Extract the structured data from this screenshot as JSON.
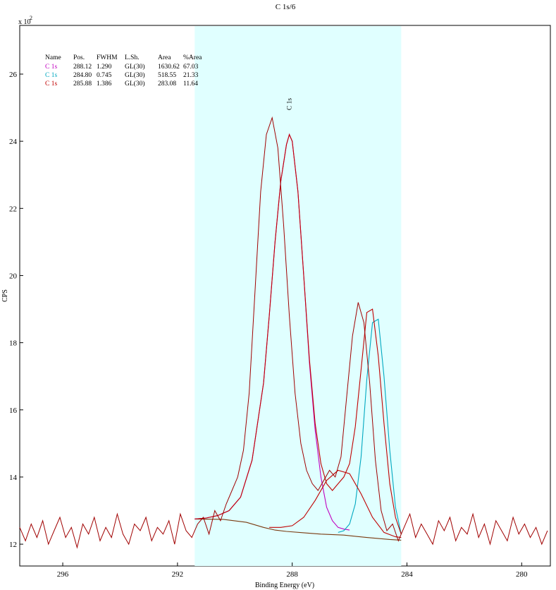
{
  "chart_data": {
    "type": "line",
    "title": "C 1s/6",
    "xlabel": "Binding Energy (eV)",
    "ylabel": "CPS",
    "y_multiplier_label": "x 10",
    "y_multiplier_exponent": "2",
    "xlim": [
      297.5,
      279
    ],
    "x_reversed": true,
    "ylim": [
      11.35,
      27.45
    ],
    "x_ticks": [
      296,
      292,
      288,
      284,
      280
    ],
    "y_ticks": [
      12,
      14,
      16,
      18,
      20,
      22,
      24,
      26
    ],
    "region": {
      "x_start": 291.4,
      "x_end": 284.2,
      "color": "#e0ffff"
    },
    "peak_label": {
      "text": "C 1s",
      "x": 288.1
    },
    "legend": {
      "headers": [
        "Name",
        "Pos.",
        "FWHM",
        "L.Sh.",
        "Area",
        "%Area"
      ],
      "rows": [
        {
          "name": "C 1s",
          "pos": "288.12",
          "fwhm": "1.290",
          "lsh": "GL(30)",
          "area": "1630.62",
          "pct": "67.03",
          "color": "#c000c0"
        },
        {
          "name": "C 1s",
          "pos": "284.80",
          "fwhm": "0.745",
          "lsh": "GL(30)",
          "area": "518.55",
          "pct": "21.33",
          "color": "#00a8c0"
        },
        {
          "name": "C 1s",
          "pos": "285.88",
          "fwhm": "1.386",
          "lsh": "GL(30)",
          "area": "283.08",
          "pct": "11.64",
          "color": "#c00000"
        }
      ]
    },
    "series": [
      {
        "role": "raw",
        "color": "#a00000",
        "x": [
          297.5,
          297.3,
          297.1,
          296.9,
          296.7,
          296.5,
          296.3,
          296.1,
          295.9,
          295.7,
          295.5,
          295.3,
          295.1,
          294.9,
          294.7,
          294.5,
          294.3,
          294.1,
          293.9,
          293.7,
          293.5,
          293.3,
          293.1,
          292.9,
          292.7,
          292.5,
          292.3,
          292.1,
          291.9,
          291.7,
          291.5,
          291.3,
          291.1,
          290.9,
          290.7,
          290.5,
          290.3,
          290.1,
          289.9,
          289.7,
          289.5,
          289.3,
          289.1,
          288.9,
          288.7,
          288.5,
          288.3,
          288.1,
          287.9,
          287.7,
          287.5,
          287.3,
          287.1,
          286.9,
          286.7,
          286.5,
          286.3,
          286.1,
          285.9,
          285.7,
          285.5,
          285.3,
          285.1,
          284.9,
          284.7,
          284.5,
          284.3,
          284.1,
          283.9,
          283.7,
          283.5,
          283.3,
          283.1,
          282.9,
          282.7,
          282.5,
          282.3,
          282.1,
          281.9,
          281.7,
          281.5,
          281.3,
          281.1,
          280.9,
          280.7,
          280.5,
          280.3,
          280.1,
          279.9,
          279.7,
          279.5,
          279.3,
          279.1
        ],
        "y": [
          12.5,
          12.1,
          12.6,
          12.2,
          12.7,
          12.0,
          12.4,
          12.8,
          12.2,
          12.5,
          11.9,
          12.6,
          12.3,
          12.8,
          12.1,
          12.5,
          12.2,
          12.9,
          12.3,
          12.0,
          12.6,
          12.4,
          12.8,
          12.1,
          12.5,
          12.3,
          12.7,
          12.0,
          12.9,
          12.4,
          12.2,
          12.6,
          12.8,
          12.3,
          13.0,
          12.7,
          13.2,
          13.6,
          14.0,
          14.8,
          16.5,
          19.5,
          22.5,
          24.2,
          24.7,
          23.8,
          21.5,
          18.8,
          16.5,
          15.0,
          14.2,
          13.8,
          13.6,
          13.9,
          14.2,
          14.0,
          14.6,
          16.4,
          18.2,
          19.2,
          18.6,
          16.8,
          14.5,
          13.0,
          12.4,
          12.6,
          12.1,
          12.5,
          12.9,
          12.2,
          12.6,
          12.3,
          12.0,
          12.7,
          12.4,
          12.8,
          12.1,
          12.5,
          12.3,
          12.9,
          12.2,
          12.6,
          12.0,
          12.7,
          12.4,
          12.1,
          12.8,
          12.3,
          12.6,
          12.2,
          12.5,
          12.0,
          12.4
        ]
      },
      {
        "role": "envelope",
        "color": "#c00000",
        "x": [
          291.4,
          291.0,
          290.6,
          290.2,
          289.8,
          289.4,
          289.0,
          288.8,
          288.6,
          288.4,
          288.2,
          288.1,
          288.0,
          287.8,
          287.6,
          287.4,
          287.2,
          287.0,
          286.8,
          286.6,
          286.4,
          286.2,
          286.0,
          285.8,
          285.6,
          285.4,
          285.2,
          285.0,
          284.8,
          284.6,
          284.4,
          284.2
        ],
        "y": [
          12.75,
          12.78,
          12.85,
          13.0,
          13.4,
          14.5,
          16.8,
          18.8,
          21.0,
          22.8,
          23.9,
          24.2,
          24.0,
          22.5,
          20.0,
          17.5,
          15.6,
          14.4,
          13.8,
          13.6,
          13.8,
          14.0,
          14.4,
          15.5,
          17.2,
          18.9,
          19.0,
          17.6,
          15.6,
          13.8,
          12.8,
          12.3
        ]
      },
      {
        "role": "component",
        "color": "#c000c0",
        "x": [
          291.4,
          291.0,
          290.6,
          290.2,
          289.8,
          289.4,
          289.0,
          288.8,
          288.6,
          288.4,
          288.2,
          288.1,
          288.0,
          287.8,
          287.6,
          287.4,
          287.2,
          287.0,
          286.8,
          286.6,
          286.4,
          286.2,
          286.0
        ],
        "y": [
          12.75,
          12.78,
          12.85,
          13.0,
          13.4,
          14.5,
          16.8,
          18.8,
          21.0,
          22.8,
          23.9,
          24.2,
          24.0,
          22.5,
          20.0,
          17.4,
          15.4,
          14.0,
          13.1,
          12.7,
          12.5,
          12.45,
          12.42
        ]
      },
      {
        "role": "component",
        "color": "#00a8c0",
        "x": [
          286.4,
          286.2,
          286.0,
          285.8,
          285.6,
          285.4,
          285.2,
          285.0,
          284.8,
          284.6,
          284.4,
          284.2
        ],
        "y": [
          12.35,
          12.4,
          12.6,
          13.2,
          14.6,
          16.9,
          18.6,
          18.7,
          17.0,
          14.8,
          13.1,
          12.3
        ]
      },
      {
        "role": "component",
        "color": "#c00000",
        "x": [
          288.8,
          288.4,
          288.0,
          287.6,
          287.2,
          286.8,
          286.4,
          286.0,
          285.6,
          285.2,
          284.8,
          284.4,
          284.2
        ],
        "y": [
          12.5,
          12.5,
          12.55,
          12.8,
          13.3,
          13.9,
          14.2,
          14.1,
          13.5,
          12.8,
          12.35,
          12.22,
          12.2
        ]
      },
      {
        "role": "background",
        "color": "#7a3a10",
        "x": [
          291.4,
          290.4,
          289.6,
          289.0,
          288.6,
          288.2,
          287.6,
          287.0,
          286.2,
          285.4,
          284.6,
          284.2
        ],
        "y": [
          12.75,
          12.74,
          12.65,
          12.5,
          12.42,
          12.38,
          12.34,
          12.3,
          12.27,
          12.2,
          12.14,
          12.12
        ]
      }
    ]
  }
}
